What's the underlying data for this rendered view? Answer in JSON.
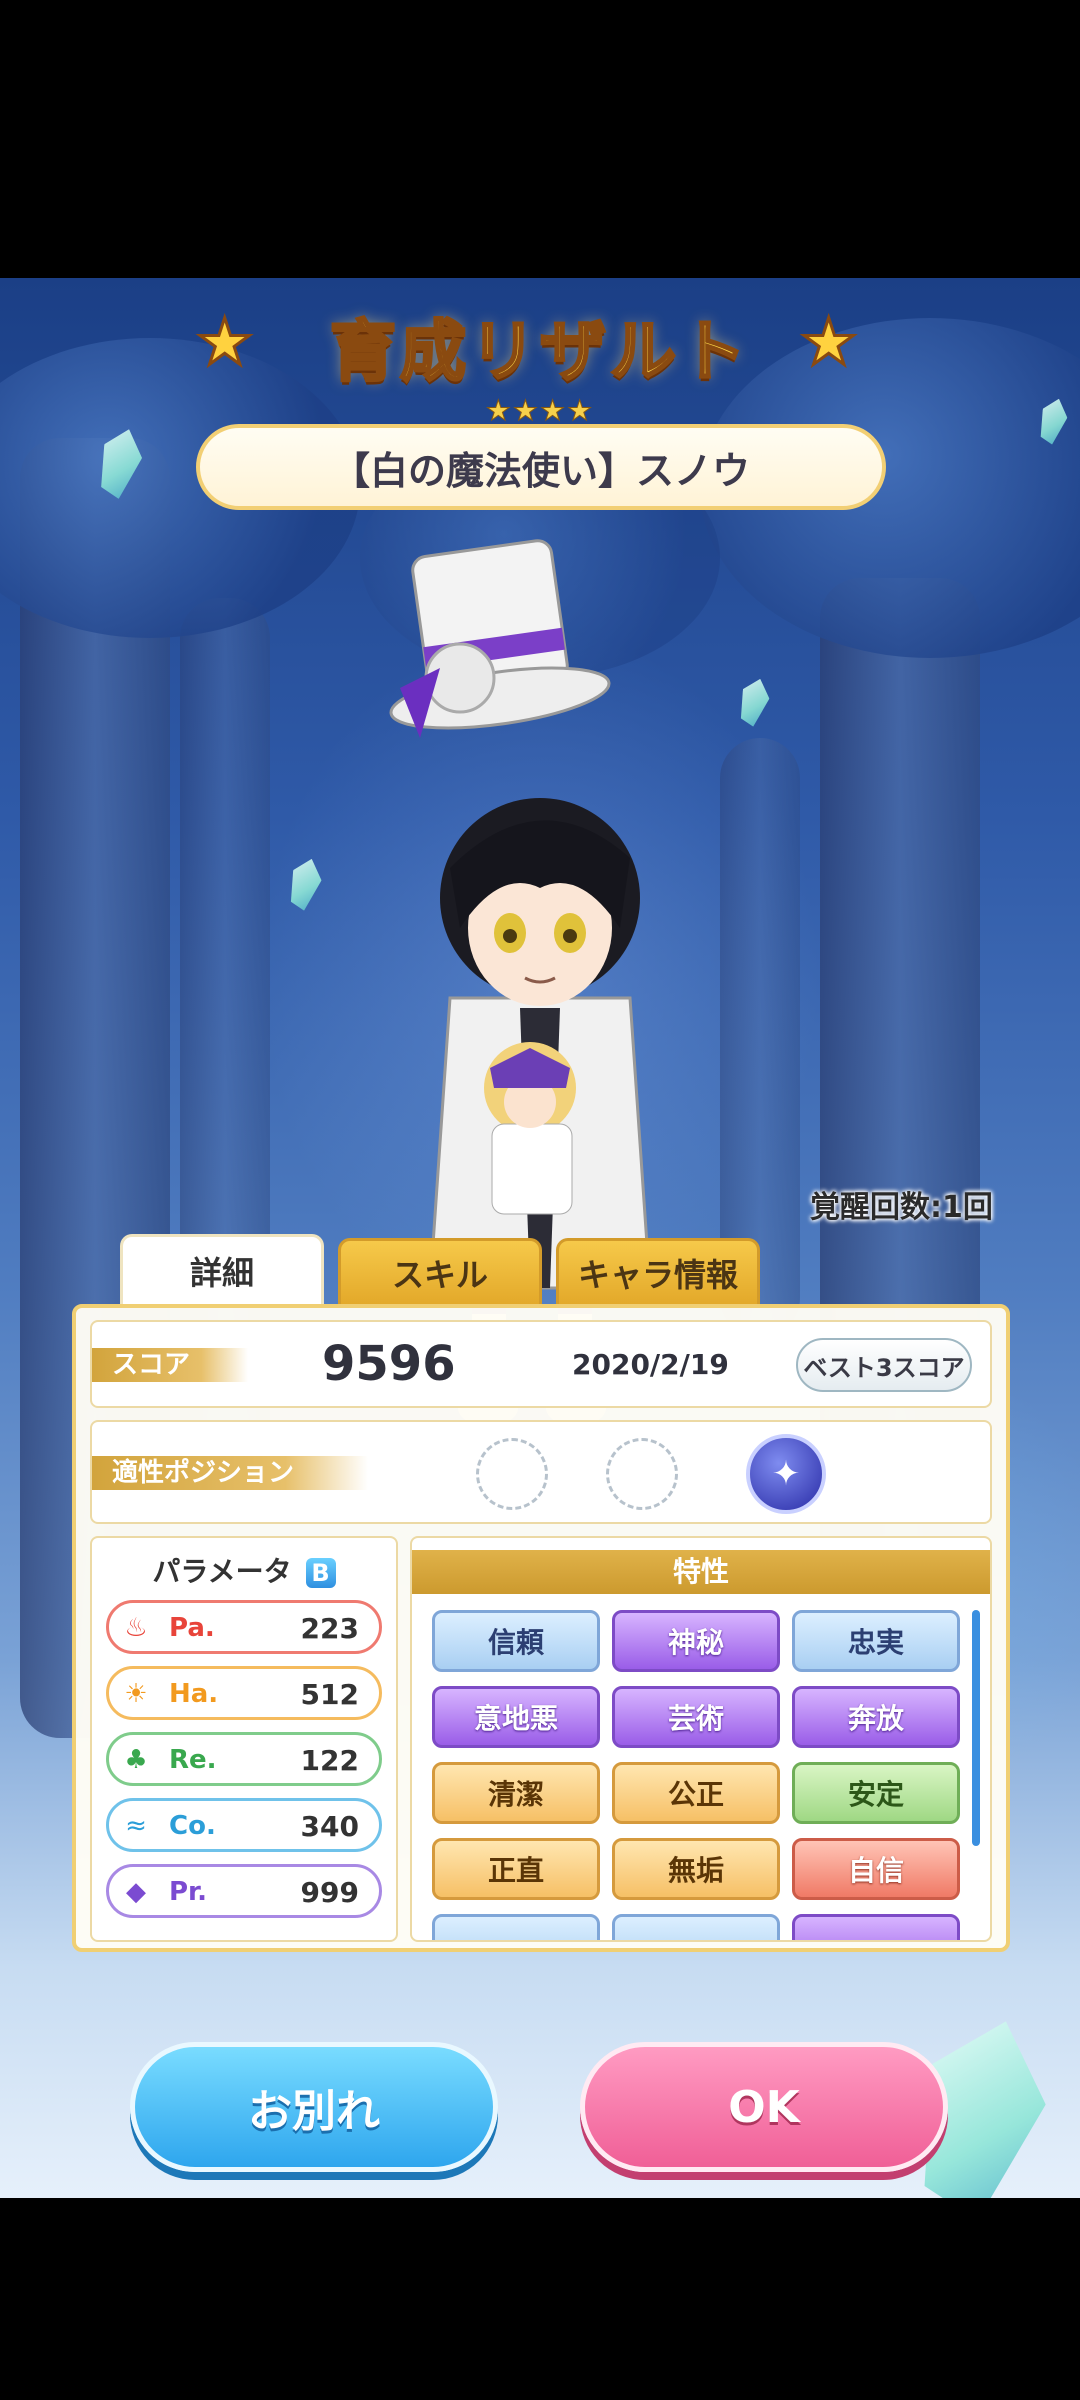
{
  "header": {
    "title": "育成リザルト",
    "rarity_stars": "★★★★",
    "character_name": "【白の魔法使い】スノウ"
  },
  "awakening": "覚醒回数:1回",
  "tabs": [
    {
      "label": "詳細",
      "active": true
    },
    {
      "label": "スキル",
      "active": false
    },
    {
      "label": "キャラ情報",
      "active": false
    }
  ],
  "score": {
    "label": "スコア",
    "value": "9596",
    "date": "2020/2/19",
    "best_button": "ベスト3スコア"
  },
  "position": {
    "label": "適性ポジション"
  },
  "parameters": {
    "title": "パラメータ",
    "rank": "B",
    "items": [
      {
        "name": "Pa.",
        "value": "223",
        "icon": "flame-icon",
        "color": "#e8443a"
      },
      {
        "name": "Ha.",
        "value": "512",
        "icon": "sun-icon",
        "color": "#f29a1f"
      },
      {
        "name": "Re.",
        "value": "122",
        "icon": "clover-icon",
        "color": "#39a84e"
      },
      {
        "name": "Co.",
        "value": "340",
        "icon": "wave-icon",
        "color": "#2b9ed8"
      },
      {
        "name": "Pr.",
        "value": "999",
        "icon": "diamond-icon",
        "color": "#7b4bd1"
      }
    ]
  },
  "traits": {
    "title": "特性",
    "items": [
      {
        "label": "信頼",
        "style": "t-blue"
      },
      {
        "label": "神秘",
        "style": "t-purple"
      },
      {
        "label": "忠実",
        "style": "t-blue"
      },
      {
        "label": "意地悪",
        "style": "t-purple"
      },
      {
        "label": "芸術",
        "style": "t-purple"
      },
      {
        "label": "奔放",
        "style": "t-purple"
      },
      {
        "label": "清潔",
        "style": "t-orange"
      },
      {
        "label": "公正",
        "style": "t-orange"
      },
      {
        "label": "安定",
        "style": "t-green"
      },
      {
        "label": "正直",
        "style": "t-orange"
      },
      {
        "label": "無垢",
        "style": "t-orange"
      },
      {
        "label": "自信",
        "style": "t-red"
      }
    ]
  },
  "buttons": {
    "farewell": "お別れ",
    "ok": "OK"
  }
}
